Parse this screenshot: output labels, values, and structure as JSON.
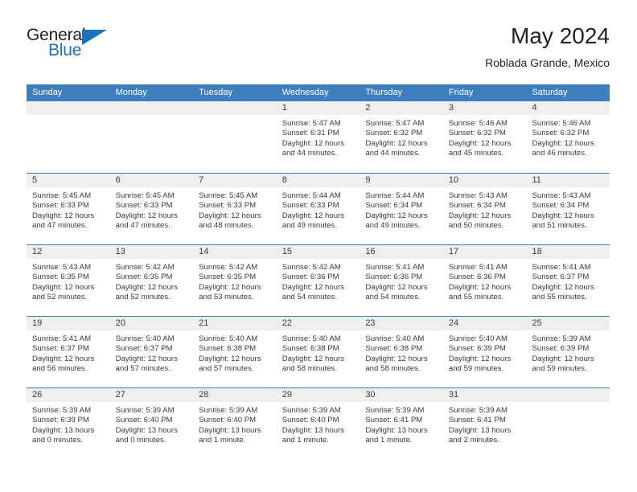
{
  "brand": {
    "word_general": "General",
    "word_blue": "Blue",
    "triangle_icon": "triangle-icon",
    "accent_color": "#1b72b8"
  },
  "header": {
    "title": "May 2024",
    "subtitle": "Roblada Grande, Mexico"
  },
  "calendar": {
    "header_bg": "#3d7ebd",
    "day_band_bg": "#efefef",
    "weekdays": [
      "Sunday",
      "Monday",
      "Tuesday",
      "Wednesday",
      "Thursday",
      "Friday",
      "Saturday"
    ],
    "weeks": [
      [
        {
          "day": "",
          "empty": true
        },
        {
          "day": "",
          "empty": true
        },
        {
          "day": "",
          "empty": true
        },
        {
          "day": "1",
          "sunrise": "Sunrise: 5:47 AM",
          "sunset": "Sunset: 6:31 PM",
          "daylight": "Daylight: 12 hours and 44 minutes."
        },
        {
          "day": "2",
          "sunrise": "Sunrise: 5:47 AM",
          "sunset": "Sunset: 6:32 PM",
          "daylight": "Daylight: 12 hours and 44 minutes."
        },
        {
          "day": "3",
          "sunrise": "Sunrise: 5:46 AM",
          "sunset": "Sunset: 6:32 PM",
          "daylight": "Daylight: 12 hours and 45 minutes."
        },
        {
          "day": "4",
          "sunrise": "Sunrise: 5:46 AM",
          "sunset": "Sunset: 6:32 PM",
          "daylight": "Daylight: 12 hours and 46 minutes."
        }
      ],
      [
        {
          "day": "5",
          "sunrise": "Sunrise: 5:45 AM",
          "sunset": "Sunset: 6:33 PM",
          "daylight": "Daylight: 12 hours and 47 minutes."
        },
        {
          "day": "6",
          "sunrise": "Sunrise: 5:45 AM",
          "sunset": "Sunset: 6:33 PM",
          "daylight": "Daylight: 12 hours and 47 minutes."
        },
        {
          "day": "7",
          "sunrise": "Sunrise: 5:45 AM",
          "sunset": "Sunset: 6:33 PM",
          "daylight": "Daylight: 12 hours and 48 minutes."
        },
        {
          "day": "8",
          "sunrise": "Sunrise: 5:44 AM",
          "sunset": "Sunset: 6:33 PM",
          "daylight": "Daylight: 12 hours and 49 minutes."
        },
        {
          "day": "9",
          "sunrise": "Sunrise: 5:44 AM",
          "sunset": "Sunset: 6:34 PM",
          "daylight": "Daylight: 12 hours and 49 minutes."
        },
        {
          "day": "10",
          "sunrise": "Sunrise: 5:43 AM",
          "sunset": "Sunset: 6:34 PM",
          "daylight": "Daylight: 12 hours and 50 minutes."
        },
        {
          "day": "11",
          "sunrise": "Sunrise: 5:43 AM",
          "sunset": "Sunset: 6:34 PM",
          "daylight": "Daylight: 12 hours and 51 minutes."
        }
      ],
      [
        {
          "day": "12",
          "sunrise": "Sunrise: 5:43 AM",
          "sunset": "Sunset: 6:35 PM",
          "daylight": "Daylight: 12 hours and 52 minutes."
        },
        {
          "day": "13",
          "sunrise": "Sunrise: 5:42 AM",
          "sunset": "Sunset: 6:35 PM",
          "daylight": "Daylight: 12 hours and 52 minutes."
        },
        {
          "day": "14",
          "sunrise": "Sunrise: 5:42 AM",
          "sunset": "Sunset: 6:35 PM",
          "daylight": "Daylight: 12 hours and 53 minutes."
        },
        {
          "day": "15",
          "sunrise": "Sunrise: 5:42 AM",
          "sunset": "Sunset: 6:36 PM",
          "daylight": "Daylight: 12 hours and 54 minutes."
        },
        {
          "day": "16",
          "sunrise": "Sunrise: 5:41 AM",
          "sunset": "Sunset: 6:36 PM",
          "daylight": "Daylight: 12 hours and 54 minutes."
        },
        {
          "day": "17",
          "sunrise": "Sunrise: 5:41 AM",
          "sunset": "Sunset: 6:36 PM",
          "daylight": "Daylight: 12 hours and 55 minutes."
        },
        {
          "day": "18",
          "sunrise": "Sunrise: 5:41 AM",
          "sunset": "Sunset: 6:37 PM",
          "daylight": "Daylight: 12 hours and 55 minutes."
        }
      ],
      [
        {
          "day": "19",
          "sunrise": "Sunrise: 5:41 AM",
          "sunset": "Sunset: 6:37 PM",
          "daylight": "Daylight: 12 hours and 56 minutes."
        },
        {
          "day": "20",
          "sunrise": "Sunrise: 5:40 AM",
          "sunset": "Sunset: 6:37 PM",
          "daylight": "Daylight: 12 hours and 57 minutes."
        },
        {
          "day": "21",
          "sunrise": "Sunrise: 5:40 AM",
          "sunset": "Sunset: 6:38 PM",
          "daylight": "Daylight: 12 hours and 57 minutes."
        },
        {
          "day": "22",
          "sunrise": "Sunrise: 5:40 AM",
          "sunset": "Sunset: 6:38 PM",
          "daylight": "Daylight: 12 hours and 58 minutes."
        },
        {
          "day": "23",
          "sunrise": "Sunrise: 5:40 AM",
          "sunset": "Sunset: 6:38 PM",
          "daylight": "Daylight: 12 hours and 58 minutes."
        },
        {
          "day": "24",
          "sunrise": "Sunrise: 5:40 AM",
          "sunset": "Sunset: 6:39 PM",
          "daylight": "Daylight: 12 hours and 59 minutes."
        },
        {
          "day": "25",
          "sunrise": "Sunrise: 5:39 AM",
          "sunset": "Sunset: 6:39 PM",
          "daylight": "Daylight: 12 hours and 59 minutes."
        }
      ],
      [
        {
          "day": "26",
          "sunrise": "Sunrise: 5:39 AM",
          "sunset": "Sunset: 6:39 PM",
          "daylight": "Daylight: 13 hours and 0 minutes."
        },
        {
          "day": "27",
          "sunrise": "Sunrise: 5:39 AM",
          "sunset": "Sunset: 6:40 PM",
          "daylight": "Daylight: 13 hours and 0 minutes."
        },
        {
          "day": "28",
          "sunrise": "Sunrise: 5:39 AM",
          "sunset": "Sunset: 6:40 PM",
          "daylight": "Daylight: 13 hours and 1 minute."
        },
        {
          "day": "29",
          "sunrise": "Sunrise: 5:39 AM",
          "sunset": "Sunset: 6:40 PM",
          "daylight": "Daylight: 13 hours and 1 minute."
        },
        {
          "day": "30",
          "sunrise": "Sunrise: 5:39 AM",
          "sunset": "Sunset: 6:41 PM",
          "daylight": "Daylight: 13 hours and 1 minute."
        },
        {
          "day": "31",
          "sunrise": "Sunrise: 5:39 AM",
          "sunset": "Sunset: 6:41 PM",
          "daylight": "Daylight: 13 hours and 2 minutes."
        },
        {
          "day": "",
          "empty": true
        }
      ]
    ]
  }
}
